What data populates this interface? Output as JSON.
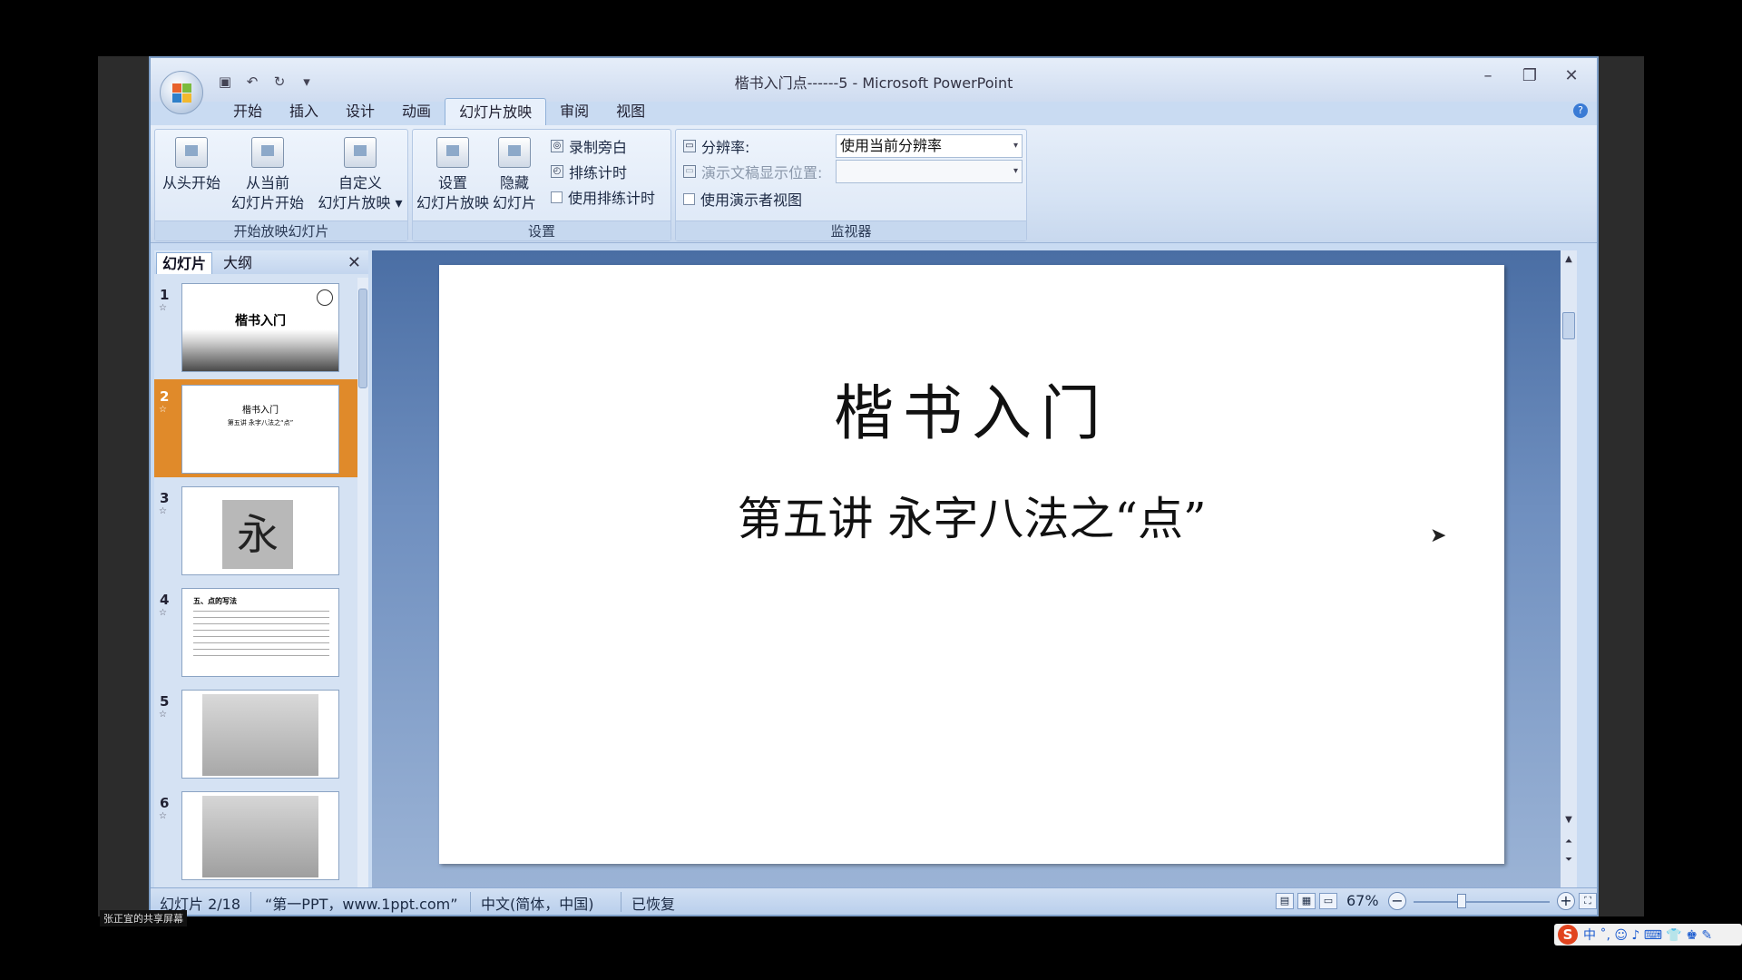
{
  "window": {
    "title": "楷书入门点------5 - Microsoft PowerPoint"
  },
  "qat": {
    "save_icon": "save-icon",
    "undo_icon": "undo-icon",
    "redo_icon": "redo-icon",
    "customize_icon": "dropdown-icon"
  },
  "tabs": [
    {
      "label": "开始"
    },
    {
      "label": "插入"
    },
    {
      "label": "设计"
    },
    {
      "label": "动画"
    },
    {
      "label": "幻灯片放映",
      "active": true
    },
    {
      "label": "审阅"
    },
    {
      "label": "视图"
    }
  ],
  "ribbon": {
    "groups": {
      "start_show": {
        "label": "开始放映幻灯片",
        "from_beginning": "从头开始",
        "from_current_line1": "从当前",
        "from_current_line2": "幻灯片开始",
        "custom_line1": "自定义",
        "custom_line2": "幻灯片放映"
      },
      "setup": {
        "label": "设置",
        "setup_line1": "设置",
        "setup_line2": "幻灯片放映",
        "hide_line1": "隐藏",
        "hide_line2": "幻灯片",
        "record_narration": "录制旁白",
        "rehearse_timings": "排练计时",
        "use_timings": "使用排练计时"
      },
      "monitors": {
        "label": "监视器",
        "resolution_label": "分辨率:",
        "resolution_value": "使用当前分辨率",
        "show_on_label": "演示文稿显示位置:",
        "show_on_value": "",
        "presenter_view": "使用演示者视图"
      }
    }
  },
  "slides_pane": {
    "tab_slides": "幻灯片",
    "tab_outline": "大纲",
    "selected_index": 2,
    "thumbnails": [
      {
        "num": "1",
        "title": "楷书入门"
      },
      {
        "num": "2",
        "line1": "楷书入门",
        "line2": "第五讲  永字八法之“点”"
      },
      {
        "num": "3",
        "char": "永"
      },
      {
        "num": "4",
        "heading": "五、点的写法"
      },
      {
        "num": "5"
      },
      {
        "num": "6"
      }
    ]
  },
  "slide": {
    "title": "楷书入门",
    "subtitle": "第五讲   永字八法之“点”"
  },
  "statusbar": {
    "slide_info": "幻灯片 2/18",
    "theme": "“第一PPT，www.1ppt.com”",
    "language": "中文(简体，中国)",
    "recovered": "已恢复",
    "zoom": "67%",
    "zoom_level": 0.67
  },
  "overlay": {
    "share_label": "张正宜的共享屏幕",
    "ime_text": "中 ˚, ☺ ♪ ⌨ 👕 ♚ ✎"
  },
  "colors": {
    "selected_thumb": "#e08a2a",
    "ribbon_bg": "#dce7f6",
    "workspace": "#6f8fbf"
  }
}
